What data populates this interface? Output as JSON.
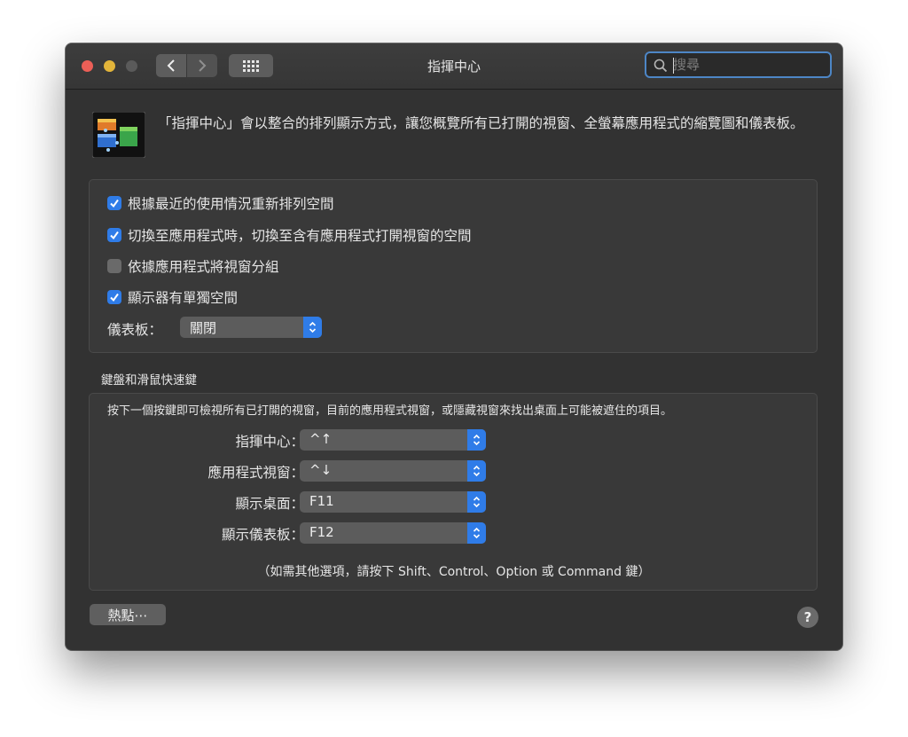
{
  "window": {
    "title": "指揮中心"
  },
  "search": {
    "placeholder": "搜尋",
    "value": ""
  },
  "description": "「指揮中心」會以整合的排列顯示方式，讓您概覽所有已打開的視窗、全螢幕應用程式的縮覽圖和儀表板。",
  "options": [
    {
      "label": "根據最近的使用情況重新排列空間",
      "checked": true
    },
    {
      "label": "切換至應用程式時，切換至含有應用程式打開視窗的空間",
      "checked": true
    },
    {
      "label": "依據應用程式將視窗分組",
      "checked": false
    },
    {
      "label": "顯示器有單獨空間",
      "checked": true
    }
  ],
  "dashboard": {
    "label": "儀表板：",
    "value": "關閉"
  },
  "shortcuts": {
    "title": "鍵盤和滑鼠快速鍵",
    "subtitle": "按下一個按鍵即可檢視所有已打開的視窗，目前的應用程式視窗，或隱藏視窗來找出桌面上可能被遮住的項目。",
    "rows": [
      {
        "label": "指揮中心：",
        "value": "^↑"
      },
      {
        "label": "應用程式視窗：",
        "value": "^↓"
      },
      {
        "label": "顯示桌面：",
        "value": "F11"
      },
      {
        "label": "顯示儀表板：",
        "value": "F12"
      }
    ],
    "note": "（如需其他選項，請按下 Shift、Control、Option 或 Command 鍵）"
  },
  "buttons": {
    "hot_corners": "熱點⋯",
    "help": "?"
  },
  "colors": {
    "accent": "#2f7ce8",
    "close": "#ec5f57",
    "minimize": "#e2b43a"
  }
}
